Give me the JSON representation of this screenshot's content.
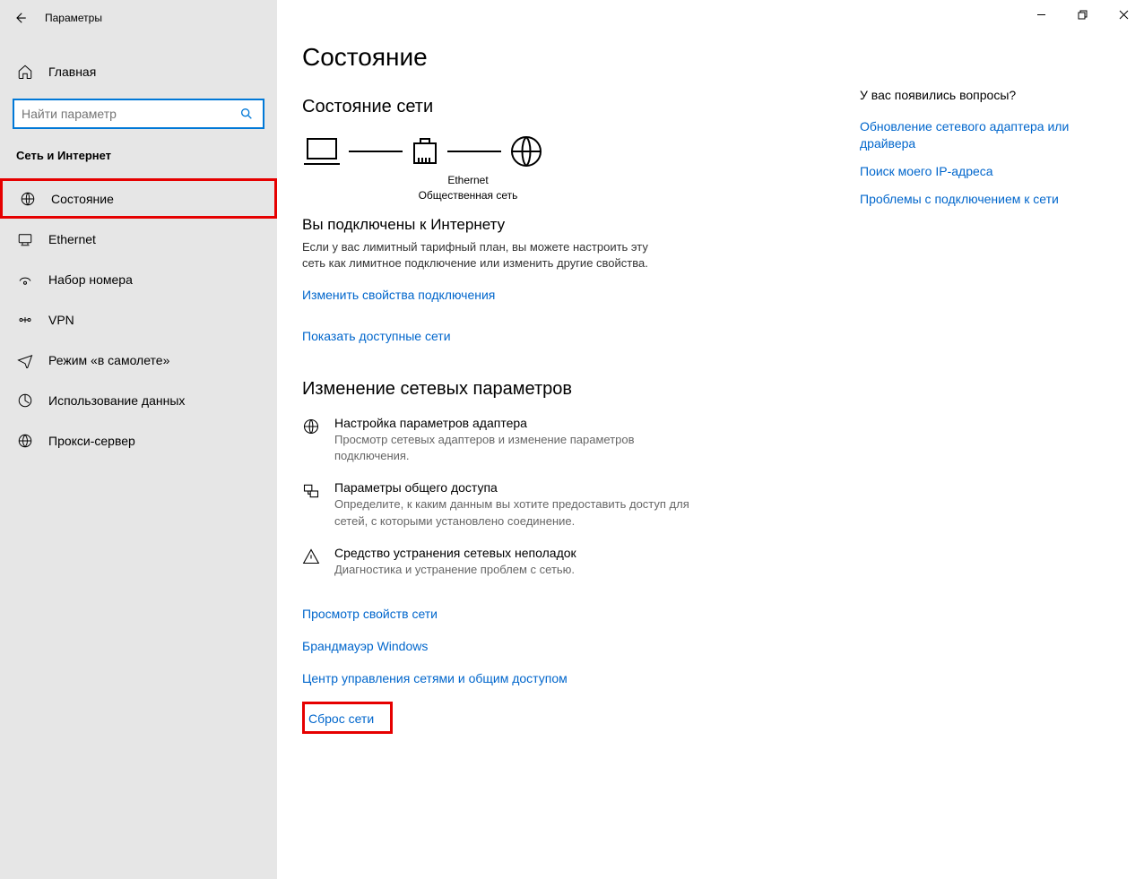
{
  "app_title": "Параметры",
  "sidebar": {
    "home": "Главная",
    "search_placeholder": "Найти параметр",
    "category": "Сеть и Интернет",
    "items": [
      {
        "label": "Состояние"
      },
      {
        "label": "Ethernet"
      },
      {
        "label": "Набор номера"
      },
      {
        "label": "VPN"
      },
      {
        "label": "Режим «в самолете»"
      },
      {
        "label": "Использование данных"
      },
      {
        "label": "Прокси-сервер"
      }
    ]
  },
  "page": {
    "title": "Состояние",
    "status": {
      "heading": "Состояние сети",
      "diagram": {
        "iface": "Ethernet",
        "net_type": "Общественная сеть"
      },
      "connected_title": "Вы подключены к Интернету",
      "connected_desc": "Если у вас лимитный тарифный план, вы можете настроить эту сеть как лимитное подключение или изменить другие свойства.",
      "change_props": "Изменить свойства подключения",
      "show_networks": "Показать доступные сети"
    },
    "change": {
      "heading": "Изменение сетевых параметров",
      "items": [
        {
          "title": "Настройка параметров адаптера",
          "desc": "Просмотр сетевых адаптеров и изменение параметров подключения."
        },
        {
          "title": "Параметры общего доступа",
          "desc": "Определите, к каким данным вы хотите предоставить доступ для сетей, с которыми установлено соединение."
        },
        {
          "title": "Средство устранения сетевых неполадок",
          "desc": "Диагностика и устранение проблем с сетью."
        }
      ],
      "links": [
        "Просмотр свойств сети",
        "Брандмауэр Windows",
        "Центр управления сетями и общим доступом"
      ],
      "reset": "Сброс сети"
    }
  },
  "help": {
    "title": "У вас появились вопросы?",
    "links": [
      "Обновление сетевого адаптера или драйвера",
      "Поиск моего IP-адреса",
      "Проблемы с подключением к сети"
    ]
  }
}
